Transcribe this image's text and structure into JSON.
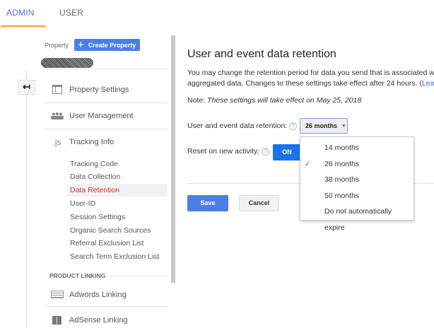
{
  "tabs": [
    {
      "label": "ADMIN",
      "active": true
    },
    {
      "label": "USER",
      "active": false
    }
  ],
  "colors": {
    "accent": "#4285f4",
    "tab_underline": "#f59b2c",
    "active_link": "#d32f2f",
    "on_button": "#1a73e8"
  },
  "sidebar": {
    "property_label": "Property",
    "create_property": "Create Property",
    "items": [
      {
        "label": "Property Settings",
        "icon": "layout-icon"
      },
      {
        "label": "User Management",
        "icon": "people-icon"
      },
      {
        "label": "Tracking Info",
        "icon": ".js"
      }
    ],
    "subitems": [
      "Tracking Code",
      "Data Collection",
      "Data Retention",
      "User-ID",
      "Session Settings",
      "Organic Search Sources",
      "Referral Exclusion List",
      "Search Term Exclusion List"
    ],
    "active_subitem": "Data Retention",
    "section_heading": "PRODUCT LINKING",
    "linking": [
      {
        "label": "Adwords Linking",
        "icon": "adwords-icon"
      },
      {
        "label": "AdSense Linking",
        "icon": "adsense-icon"
      }
    ]
  },
  "main": {
    "title": "User and event data retention",
    "description_line1": "You may change the retention period for data you send that is associated wi",
    "description_line2": "aggregated data. Changes to these settings take effect after 24 hours. (",
    "learn_link": "Lear",
    "note_label": "Note:",
    "note_text": "These settings will take effect on May 25, 2018",
    "retention_label": "User and event data retention:",
    "retention_value": "26 months",
    "reset_label": "Reset on new activity:",
    "reset_value": "ON",
    "help": "?",
    "options": [
      "14 months",
      "26 months",
      "38 months",
      "50 months",
      "Do not automatically expire"
    ],
    "selected_option": "26 months",
    "save": "Save",
    "cancel": "Cancel"
  }
}
